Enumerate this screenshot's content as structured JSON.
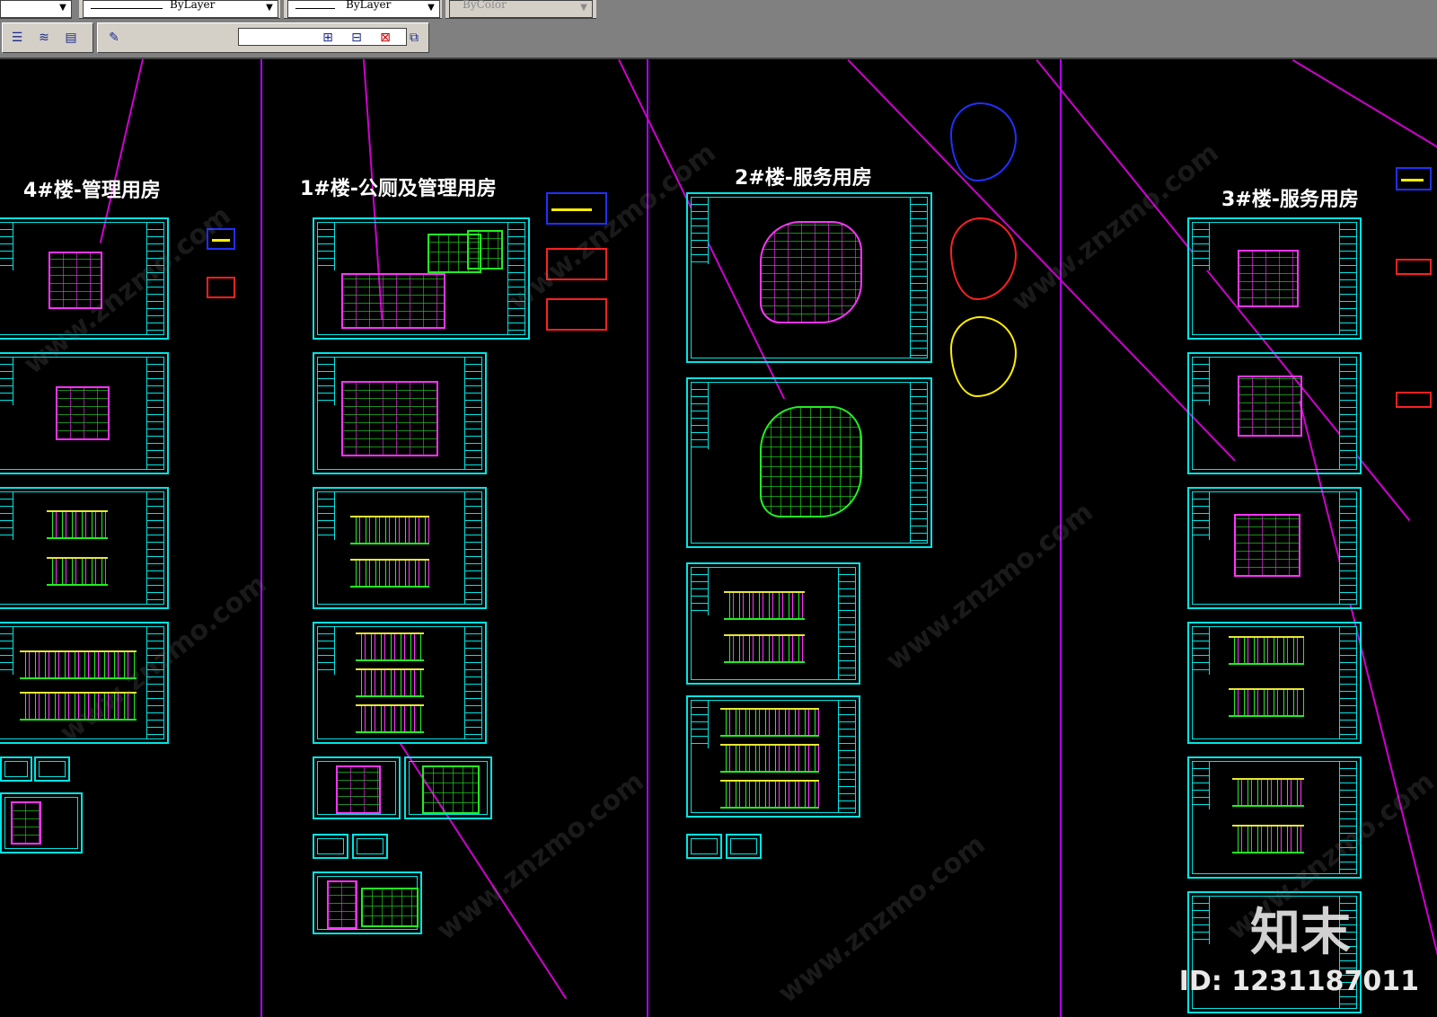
{
  "toolbar": {
    "linetype": {
      "value": "ByLayer"
    },
    "lineweight": {
      "value": "ByLayer"
    },
    "plotstyle": {
      "value": "ByColor"
    },
    "name_field": {
      "value": ""
    }
  },
  "drawing": {
    "titles": [
      "4#楼-管理用房",
      "1#楼-公厕及管理用房",
      "2#楼-服务用房",
      "3#楼-服务用房"
    ],
    "colors": {
      "background": "#000000",
      "sheet_frame": "#00e5e5",
      "divider": "#b000ff",
      "plan": "#22ee22",
      "accent_magenta": "#ff33ff",
      "tag_red": "#ff2020",
      "tag_blue": "#2030ff",
      "tag_yellow": "#ffee00"
    }
  },
  "watermark": {
    "site": "www.znzmo.com",
    "logo": "知末",
    "id": "ID: 1231187011"
  }
}
